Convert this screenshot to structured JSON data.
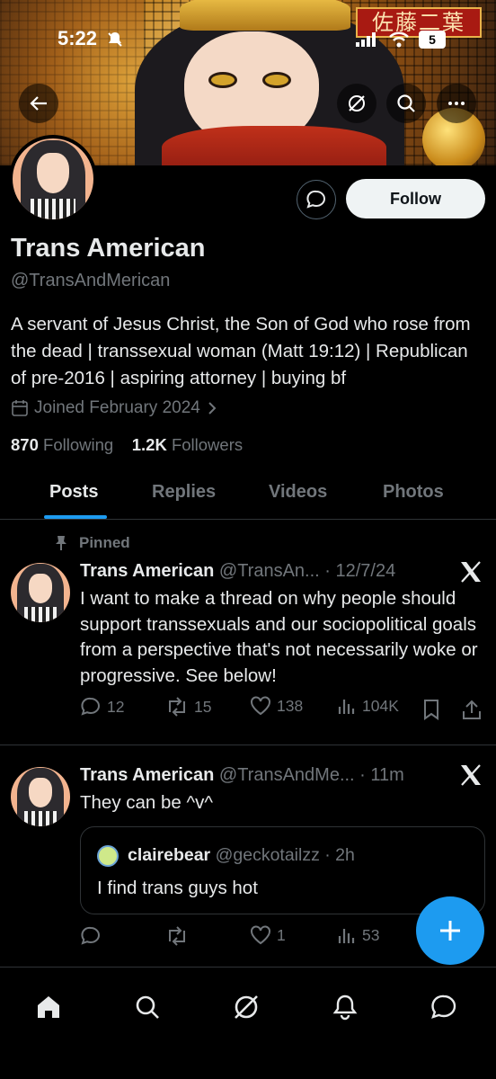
{
  "status_bar": {
    "time": "5:22",
    "battery": "5"
  },
  "banner": {
    "stamp_text": "佐藤二葉"
  },
  "header_icons": [
    "back-arrow-icon",
    "grok-icon",
    "search-icon",
    "more-icon"
  ],
  "profile": {
    "name": "Trans American",
    "handle": "@TransAndMerican",
    "bio": "A servant of Jesus Christ, the Son of God who rose from the dead | transsexual woman (Matt 19:12) | Republican of pre-2016 | aspiring attorney | buying bf",
    "joined": "Joined February 2024",
    "following_count": "870",
    "following_label": "Following",
    "followers_count": "1.2K",
    "followers_label": "Followers",
    "follow_label": "Follow"
  },
  "tabs": [
    {
      "label": "Posts",
      "active": true
    },
    {
      "label": "Replies",
      "active": false
    },
    {
      "label": "Videos",
      "active": false
    },
    {
      "label": "Photos",
      "active": false
    }
  ],
  "posts": [
    {
      "pinned_label": "Pinned",
      "name": "Trans American",
      "meta": "@TransAn... · 12/7/24",
      "text": "I want to make a thread on why people should support transsexuals and our sociopolitical goals from a perspective that's not necessarily woke or progressive. See below!",
      "replies": "12",
      "reposts": "15",
      "likes": "138",
      "views": "104K"
    },
    {
      "name": "Trans American",
      "meta": "@TransAndMe... · 11m",
      "text": "They can be ^v^",
      "quote": {
        "name": "clairebear",
        "meta": "@geckotailzz · 2h",
        "text": "I find trans guys hot"
      },
      "replies": "",
      "reposts": "",
      "likes": "1",
      "views": "53"
    }
  ],
  "colors": {
    "accent": "#1d9bf0",
    "background": "#000000",
    "muted": "#71767b",
    "text": "#e7e9ea"
  },
  "bottom_nav": [
    "home-icon",
    "search-icon",
    "grok-icon",
    "notifications-icon",
    "messages-icon"
  ]
}
